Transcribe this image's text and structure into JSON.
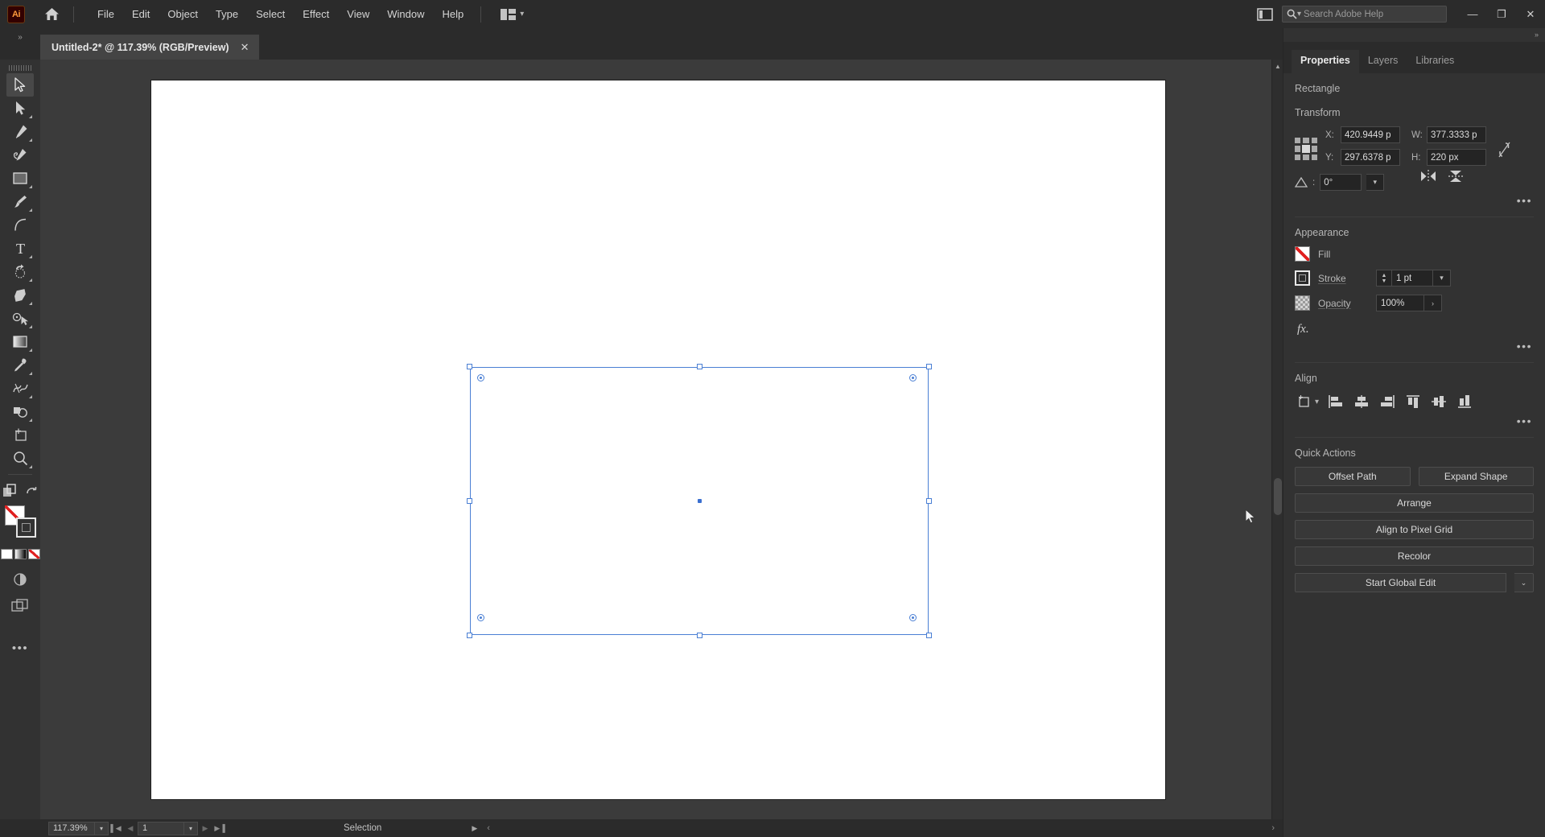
{
  "app": {
    "logo_text": "Ai",
    "home_icon": "home-icon",
    "arrange_icon": "arrange-layout-icon"
  },
  "menubar": {
    "items": [
      "File",
      "Edit",
      "Object",
      "Type",
      "Select",
      "Effect",
      "View",
      "Window",
      "Help"
    ],
    "search": {
      "placeholder": "Search Adobe Help",
      "value": "",
      "icon": "search-icon"
    },
    "panel_toggle_icon": "panel-toggle-icon",
    "window_controls": {
      "minimize": "—",
      "maximize": "❐",
      "close": "✕"
    }
  },
  "tabbar": {
    "collapse_icon": "»",
    "document_title": "Untitled-2* @ 117.39% (RGB/Preview)",
    "close_label": "✕"
  },
  "toolbar": {
    "tools": [
      {
        "name": "selection-tool",
        "active": true,
        "has_flyout": false
      },
      {
        "name": "direct-selection-tool",
        "active": false,
        "has_flyout": true
      },
      {
        "name": "pen-tool",
        "active": false,
        "has_flyout": true
      },
      {
        "name": "curvature-tool",
        "active": false,
        "has_flyout": false
      },
      {
        "name": "rectangle-tool",
        "active": false,
        "has_flyout": true
      },
      {
        "name": "paintbrush-tool",
        "active": false,
        "has_flyout": true
      },
      {
        "name": "arc-tool",
        "active": false,
        "has_flyout": false
      },
      {
        "name": "type-tool",
        "active": false,
        "has_flyout": true
      },
      {
        "name": "rotate-tool",
        "active": false,
        "has_flyout": true
      },
      {
        "name": "eraser-tool",
        "active": false,
        "has_flyout": true
      },
      {
        "name": "scale-tool",
        "active": false,
        "has_flyout": true
      },
      {
        "name": "gradient-tool",
        "active": false,
        "has_flyout": true
      },
      {
        "name": "eyedropper-tool",
        "active": false,
        "has_flyout": true
      },
      {
        "name": "blend-tool",
        "active": false,
        "has_flyout": true
      },
      {
        "name": "shape-builder-tool",
        "active": false,
        "has_flyout": true
      },
      {
        "name": "artboard-tool",
        "active": false,
        "has_flyout": false
      },
      {
        "name": "zoom-tool",
        "active": false,
        "has_flyout": true
      }
    ],
    "edit_toolbar_icon": "edit-toolbar-icon",
    "fill_swatch": "none",
    "stroke_swatch": "black",
    "swap_icon": "swap-fill-stroke-icon",
    "color_modes": [
      "color-white",
      "gradient",
      "none"
    ],
    "drawing_mode_icon": "drawing-mode-icon",
    "screen_mode_icon": "screen-mode-icon",
    "more_tools_icon": "more-tools-icon"
  },
  "canvas": {
    "artboard_bg": "#ffffff",
    "workspace_bg": "#3b3b3b",
    "selection_color": "#4a7fd4",
    "selection": {
      "handles": 8,
      "corner_radius_widgets": 4,
      "center_point": true
    },
    "cursor": "selection-arrow-cursor"
  },
  "statusbar": {
    "zoom_level": "117.39%",
    "artboard_number": "1",
    "current_tool": "Selection",
    "first_icon": "▌◀",
    "prev_icon": "◀",
    "next_icon": "▶",
    "last_icon": "▶▐"
  },
  "properties": {
    "tabs": [
      {
        "label": "Properties",
        "active": true
      },
      {
        "label": "Layers",
        "active": false
      },
      {
        "label": "Libraries",
        "active": false
      }
    ],
    "object_type": "Rectangle",
    "transform": {
      "title": "Transform",
      "x_label": "X:",
      "x_value": "420.9449 p",
      "y_label": "Y:",
      "y_value": "297.6378 p",
      "w_label": "W:",
      "w_value": "377.3333 p",
      "h_label": "H:",
      "h_value": "220 px",
      "angle_label": "angle-icon",
      "angle_value": "0°",
      "link_icon": "unlink-proportions-icon",
      "flip_horizontal_icon": "flip-horizontal-icon",
      "flip_vertical_icon": "flip-vertical-icon",
      "reference_point": "center",
      "more_options": "•••"
    },
    "appearance": {
      "title": "Appearance",
      "fill_label": "Fill",
      "fill_value": "none",
      "stroke_label": "Stroke",
      "stroke_weight": "1 pt",
      "opacity_label": "Opacity",
      "opacity_value": "100%",
      "fx_label": "fx.",
      "more_options": "•••"
    },
    "align": {
      "title": "Align",
      "align_to_icon": "align-to-selection-icon",
      "buttons": [
        "align-left-icon",
        "align-horizontal-center-icon",
        "align-right-icon",
        "align-top-icon",
        "align-vertical-center-icon",
        "align-bottom-icon"
      ],
      "more_options": "•••"
    },
    "quick_actions": {
      "title": "Quick Actions",
      "offset_path": "Offset Path",
      "expand_shape": "Expand Shape",
      "arrange": "Arrange",
      "align_pixel_grid": "Align to Pixel Grid",
      "recolor": "Recolor",
      "global_edit": "Start Global Edit",
      "global_edit_chevron": "⌄"
    }
  }
}
